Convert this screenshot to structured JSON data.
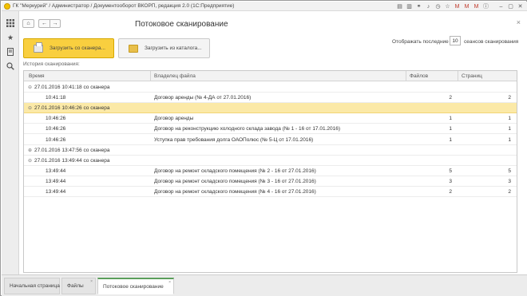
{
  "window": {
    "title": "ГК \"Меркурий\" / Администратор / Документооборот ВКОРП, редакция 2.0 (1С:Предприятие)"
  },
  "toolbar": {
    "home_icon": "⌂",
    "back_icon": "←",
    "forward_icon": "→",
    "title": "Потоковое сканирование",
    "close_icon": "×"
  },
  "actions": {
    "scan_label": "Загрузить со сканера...",
    "catalog_label": "Загрузить из каталога..."
  },
  "settings": {
    "show_last_label": "Отображать последние",
    "sessions_count": "10",
    "sessions_label": "сеансов сканирования"
  },
  "history": {
    "label": "История сканирования:",
    "columns": {
      "time": "Время",
      "owner": "Владелец файла",
      "files": "Файлов",
      "pages": "Страниц"
    },
    "rows": [
      {
        "time": "27.01.2016 10:41:18 со сканера",
        "owner": "",
        "files": "",
        "pages": "",
        "group": true,
        "toggle": "⊖"
      },
      {
        "time": "10:41:18",
        "owner": "Договор аренды (№ 4-ДА от 27.01.2016)",
        "files": "2",
        "pages": "2"
      },
      {
        "time": "27.01.2016 10:46:26 со сканера",
        "owner": "",
        "files": "",
        "pages": "",
        "group": true,
        "toggle": "⊖",
        "selected": true
      },
      {
        "time": "10:46:26",
        "owner": "Договор аренды",
        "files": "1",
        "pages": "1"
      },
      {
        "time": "10:46:26",
        "owner": "Договор на реконструкцию холодного склада завода (№ 1 - 16 от 17.01.2016)",
        "files": "1",
        "pages": "1"
      },
      {
        "time": "10:46:26",
        "owner": "Уступка прав требования долга ОАОПолюс (№ 5-Ц от 17.01.2016)",
        "files": "1",
        "pages": "1"
      },
      {
        "time": "27.01.2016 13:47:56 со сканера",
        "owner": "",
        "files": "",
        "pages": "",
        "group": true,
        "toggle": "⊕"
      },
      {
        "time": "27.01.2016 13:49:44 со сканера",
        "owner": "",
        "files": "",
        "pages": "",
        "group": true,
        "toggle": "⊖"
      },
      {
        "time": "13:49:44",
        "owner": "Договор на ремонт складского помещения (№ 2 - 16 от 27.01.2016)",
        "files": "5",
        "pages": "5"
      },
      {
        "time": "13:49:44",
        "owner": "Договор на ремонт складского помещения (№ 3 - 16 от 27.01.2016)",
        "files": "3",
        "pages": "3"
      },
      {
        "time": "13:49:44",
        "owner": "Договор на ремонт складского помещения (№ 4 - 16 от 27.01.2016)",
        "files": "2",
        "pages": "2"
      }
    ]
  },
  "tabs": [
    {
      "label": "Начальная страница",
      "closable": false
    },
    {
      "label": "Файлы",
      "closable": true
    },
    {
      "label": "Потоковое сканирование",
      "closable": true,
      "active": true
    }
  ],
  "colors": {
    "accent": "#f9cf3f",
    "selected_row": "#fbe9a7",
    "active_tab_marker": "#5a9e5a"
  },
  "icons": {
    "left_panel": [
      "menu-grid-icon",
      "favorites-star-icon",
      "history-icon",
      "search-icon"
    ]
  }
}
